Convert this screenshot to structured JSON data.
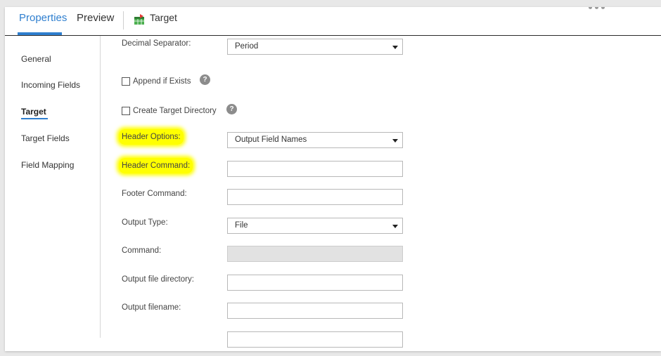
{
  "tabs": [
    {
      "label": "Properties",
      "active": true
    },
    {
      "label": "Preview",
      "active": false
    }
  ],
  "object": {
    "label": "Target",
    "icon": "target-table-icon"
  },
  "sidebar": {
    "items": [
      {
        "label": "General",
        "active": false
      },
      {
        "label": "Incoming Fields",
        "active": false
      },
      {
        "label": "Target",
        "active": true
      },
      {
        "label": "Target Fields",
        "active": false
      },
      {
        "label": "Field Mapping",
        "active": false
      }
    ]
  },
  "form": {
    "decimal_separator": {
      "label": "Decimal Separator:",
      "value": "Period"
    },
    "append_if_exists": {
      "label": "Append if Exists",
      "checked": false
    },
    "create_target_directory": {
      "label": "Create Target Directory",
      "checked": false
    },
    "header_options": {
      "label": "Header Options:",
      "value": "Output Field Names",
      "highlighted": true
    },
    "header_command": {
      "label": "Header Command:",
      "value": "",
      "highlighted": true
    },
    "footer_command": {
      "label": "Footer Command:",
      "value": ""
    },
    "output_type": {
      "label": "Output Type:",
      "value": "File"
    },
    "command": {
      "label": "Command:",
      "value": "",
      "disabled": true
    },
    "output_file_directory": {
      "label": "Output file directory:",
      "value": ""
    },
    "output_filename": {
      "label": "Output filename:",
      "value": ""
    },
    "help_icon_glyph": "?"
  },
  "colors": {
    "accent": "#2f7fcf",
    "highlight": "#ffff00"
  }
}
